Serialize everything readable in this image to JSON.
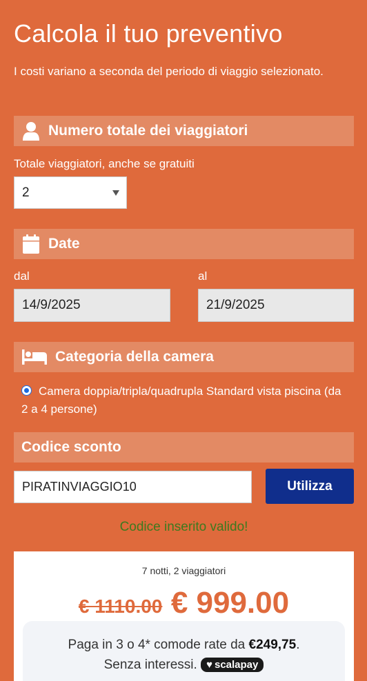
{
  "header": {
    "title": "Calcola il tuo preventivo",
    "subtitle": "I costi variano a seconda del periodo di viaggio selezionato."
  },
  "travelers": {
    "section_title": "Numero totale dei viaggiatori",
    "field_label": "Totale viaggiatori, anche se gratuiti",
    "selected_value": "2",
    "icon": "user-icon"
  },
  "dates": {
    "section_title": "Date",
    "from_label": "dal",
    "from_value": "14/9/2025",
    "to_label": "al",
    "to_value": "21/9/2025",
    "icon": "calendar-icon"
  },
  "room": {
    "section_title": "Categoria della camera",
    "option_label": "Camera doppia/tripla/quadrupla Standard vista piscina (da 2 a 4 persone)",
    "icon": "bed-icon"
  },
  "discount": {
    "section_title": "Codice sconto",
    "code_value": "PIRATINVIAGGIO10",
    "button_label": "Utilizza",
    "valid_message": "Codice inserito valido!"
  },
  "summary": {
    "nights_travelers": "7 notti, 2 viaggiatori",
    "old_price": "€ 1110.00",
    "new_price": "€ 999.00",
    "scalapay_text": "Paga in 3 o 4* comode rate da",
    "scalapay_amount": "€249,75",
    "scalapay_suffix": ".",
    "no_interest": "Senza interessi.",
    "scalapay_logo": "scalapay"
  },
  "colors": {
    "background": "#df6a3c",
    "section_bar": "#e38a64",
    "button": "#102e8c",
    "valid_text": "#3d7a1f"
  }
}
